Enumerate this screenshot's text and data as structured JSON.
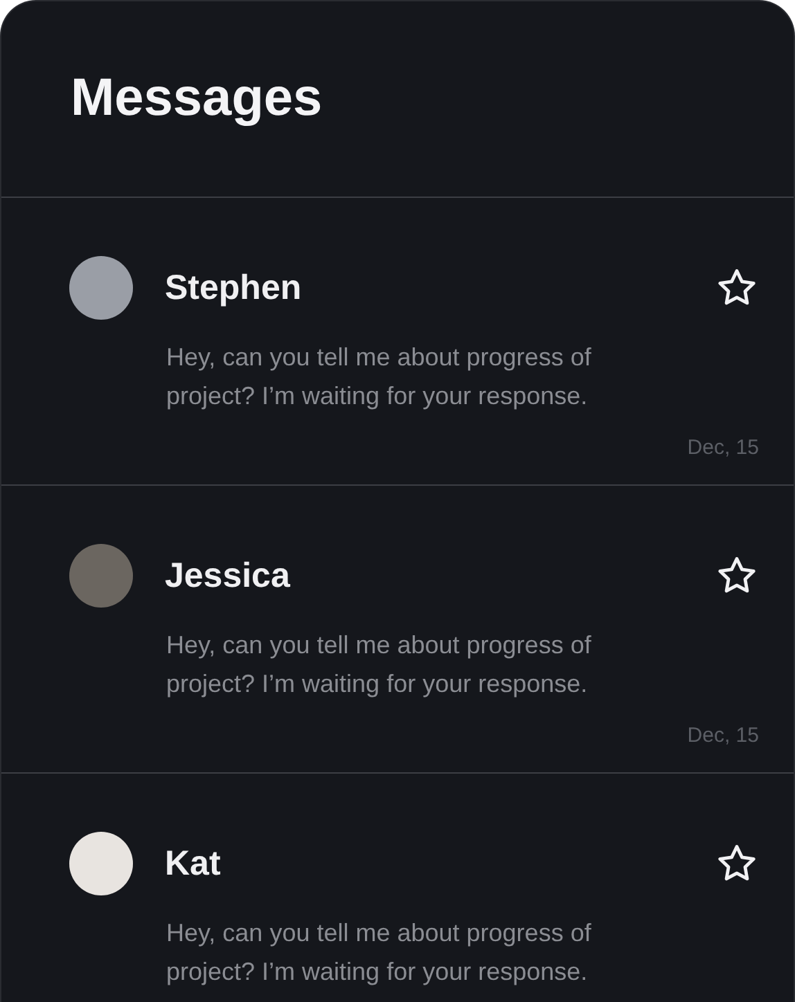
{
  "title": "Messages",
  "messages": [
    {
      "name": "Stephen",
      "text": "Hey, can you tell me about progress of project? I’m waiting for your response.",
      "date": "Dec, 15"
    },
    {
      "name": "Jessica",
      "text": "Hey, can you tell me about progress of project? I’m waiting for your response.",
      "date": "Dec, 15"
    },
    {
      "name": "Kat",
      "text": "Hey, can you tell me about progress of project? I’m waiting for your response."
    }
  ]
}
